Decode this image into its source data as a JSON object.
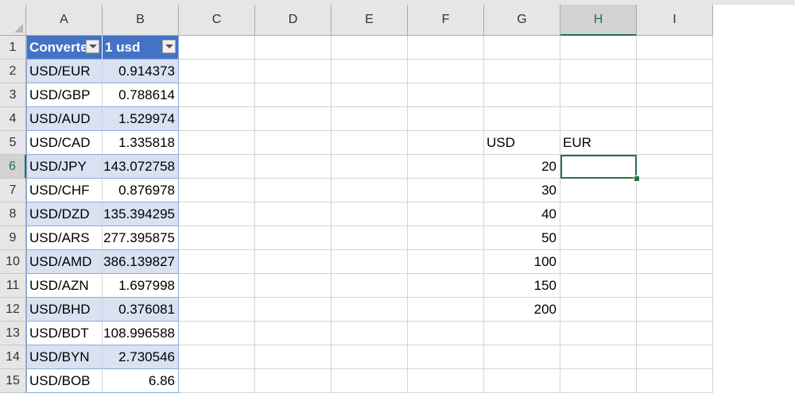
{
  "sheet": {
    "columns": [
      "A",
      "B",
      "C",
      "D",
      "E",
      "F",
      "G",
      "H",
      "I"
    ],
    "rows": [
      "1",
      "2",
      "3",
      "4",
      "5",
      "6",
      "7",
      "8",
      "9",
      "10",
      "11",
      "12",
      "13",
      "14",
      "15"
    ],
    "selected_column": "H",
    "selected_row": "6",
    "table": {
      "header_a": "Converter",
      "header_b": "1 usd",
      "rows": [
        {
          "pair": "USD/EUR",
          "rate": "0.914373"
        },
        {
          "pair": "USD/GBP",
          "rate": "0.788614"
        },
        {
          "pair": "USD/AUD",
          "rate": "1.529974"
        },
        {
          "pair": "USD/CAD",
          "rate": "1.335818"
        },
        {
          "pair": "USD/JPY",
          "rate": "143.072758"
        },
        {
          "pair": "USD/CHF",
          "rate": "0.876978"
        },
        {
          "pair": "USD/DZD",
          "rate": "135.394295"
        },
        {
          "pair": "USD/ARS",
          "rate": "277.395875"
        },
        {
          "pair": "USD/AMD",
          "rate": "386.139827"
        },
        {
          "pair": "USD/AZN",
          "rate": "1.697998"
        },
        {
          "pair": "USD/BHD",
          "rate": "0.376081"
        },
        {
          "pair": "USD/BDT",
          "rate": "108.996588"
        },
        {
          "pair": "USD/BYN",
          "rate": "2.730546"
        },
        {
          "pair": "USD/BOB",
          "rate": "6.86"
        }
      ]
    },
    "conversion": {
      "label_usd": "USD",
      "label_eur": "EUR",
      "amounts": [
        "20",
        "30",
        "40",
        "50",
        "100",
        "150",
        "200"
      ],
      "active_cell_value": ""
    }
  },
  "colors": {
    "table_header": "#4472c4",
    "table_band": "#d9e1f2",
    "selection": "#217346"
  }
}
